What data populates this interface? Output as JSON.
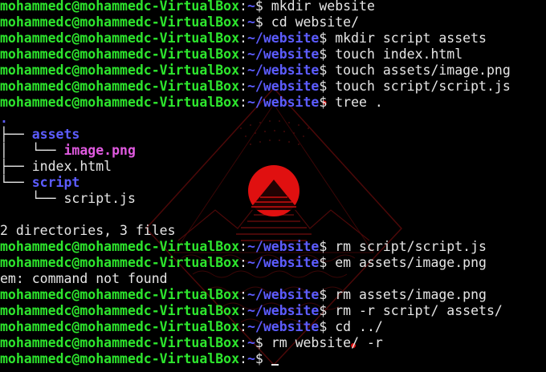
{
  "terminal": {
    "user_host": "mohammedc@mohammedc-VirtualBox",
    "colon": ":",
    "tilde": "~",
    "website_path": "~/website",
    "dollar": "$ ",
    "cmd_mkdir_website": "mkdir website",
    "cmd_cd_website": "cd website/",
    "cmd_mkdir_script_assets": "mkdir script assets",
    "cmd_touch_index": "touch index.html",
    "cmd_touch_image": "touch assets/image.png",
    "cmd_touch_script": "touch script/script.js",
    "cmd_tree": "tree .",
    "tree_root": ".",
    "tree_branch_1": "├── ",
    "tree_assets": "assets",
    "tree_sub_1": "│   └── ",
    "tree_image": "image.png",
    "tree_branch_2": "├── ",
    "tree_index": "index.html",
    "tree_branch_3": "└── ",
    "tree_script": "script",
    "tree_sub_2": "    └── ",
    "tree_scriptjs": "script.js",
    "tree_summary": "2 directories, 3 files",
    "cmd_rm_scriptjs": "rm script/script.js",
    "cmd_em_image": "em assets/image.png",
    "err_em": "em: command not found",
    "cmd_rm_image": "rm assets/image.png",
    "cmd_rm_dirs": "rm -r script/ assets/",
    "cmd_cd_up": "cd ../",
    "cmd_rm_website": "rm website/ -r"
  },
  "colors": {
    "prompt_user": "#2de62d",
    "prompt_path": "#5c5cff",
    "directory": "#5c5cff",
    "image_file": "#e05ae0",
    "text": "#e6e6e6",
    "background": "#000000",
    "wallpaper_accent": "#e01010"
  }
}
